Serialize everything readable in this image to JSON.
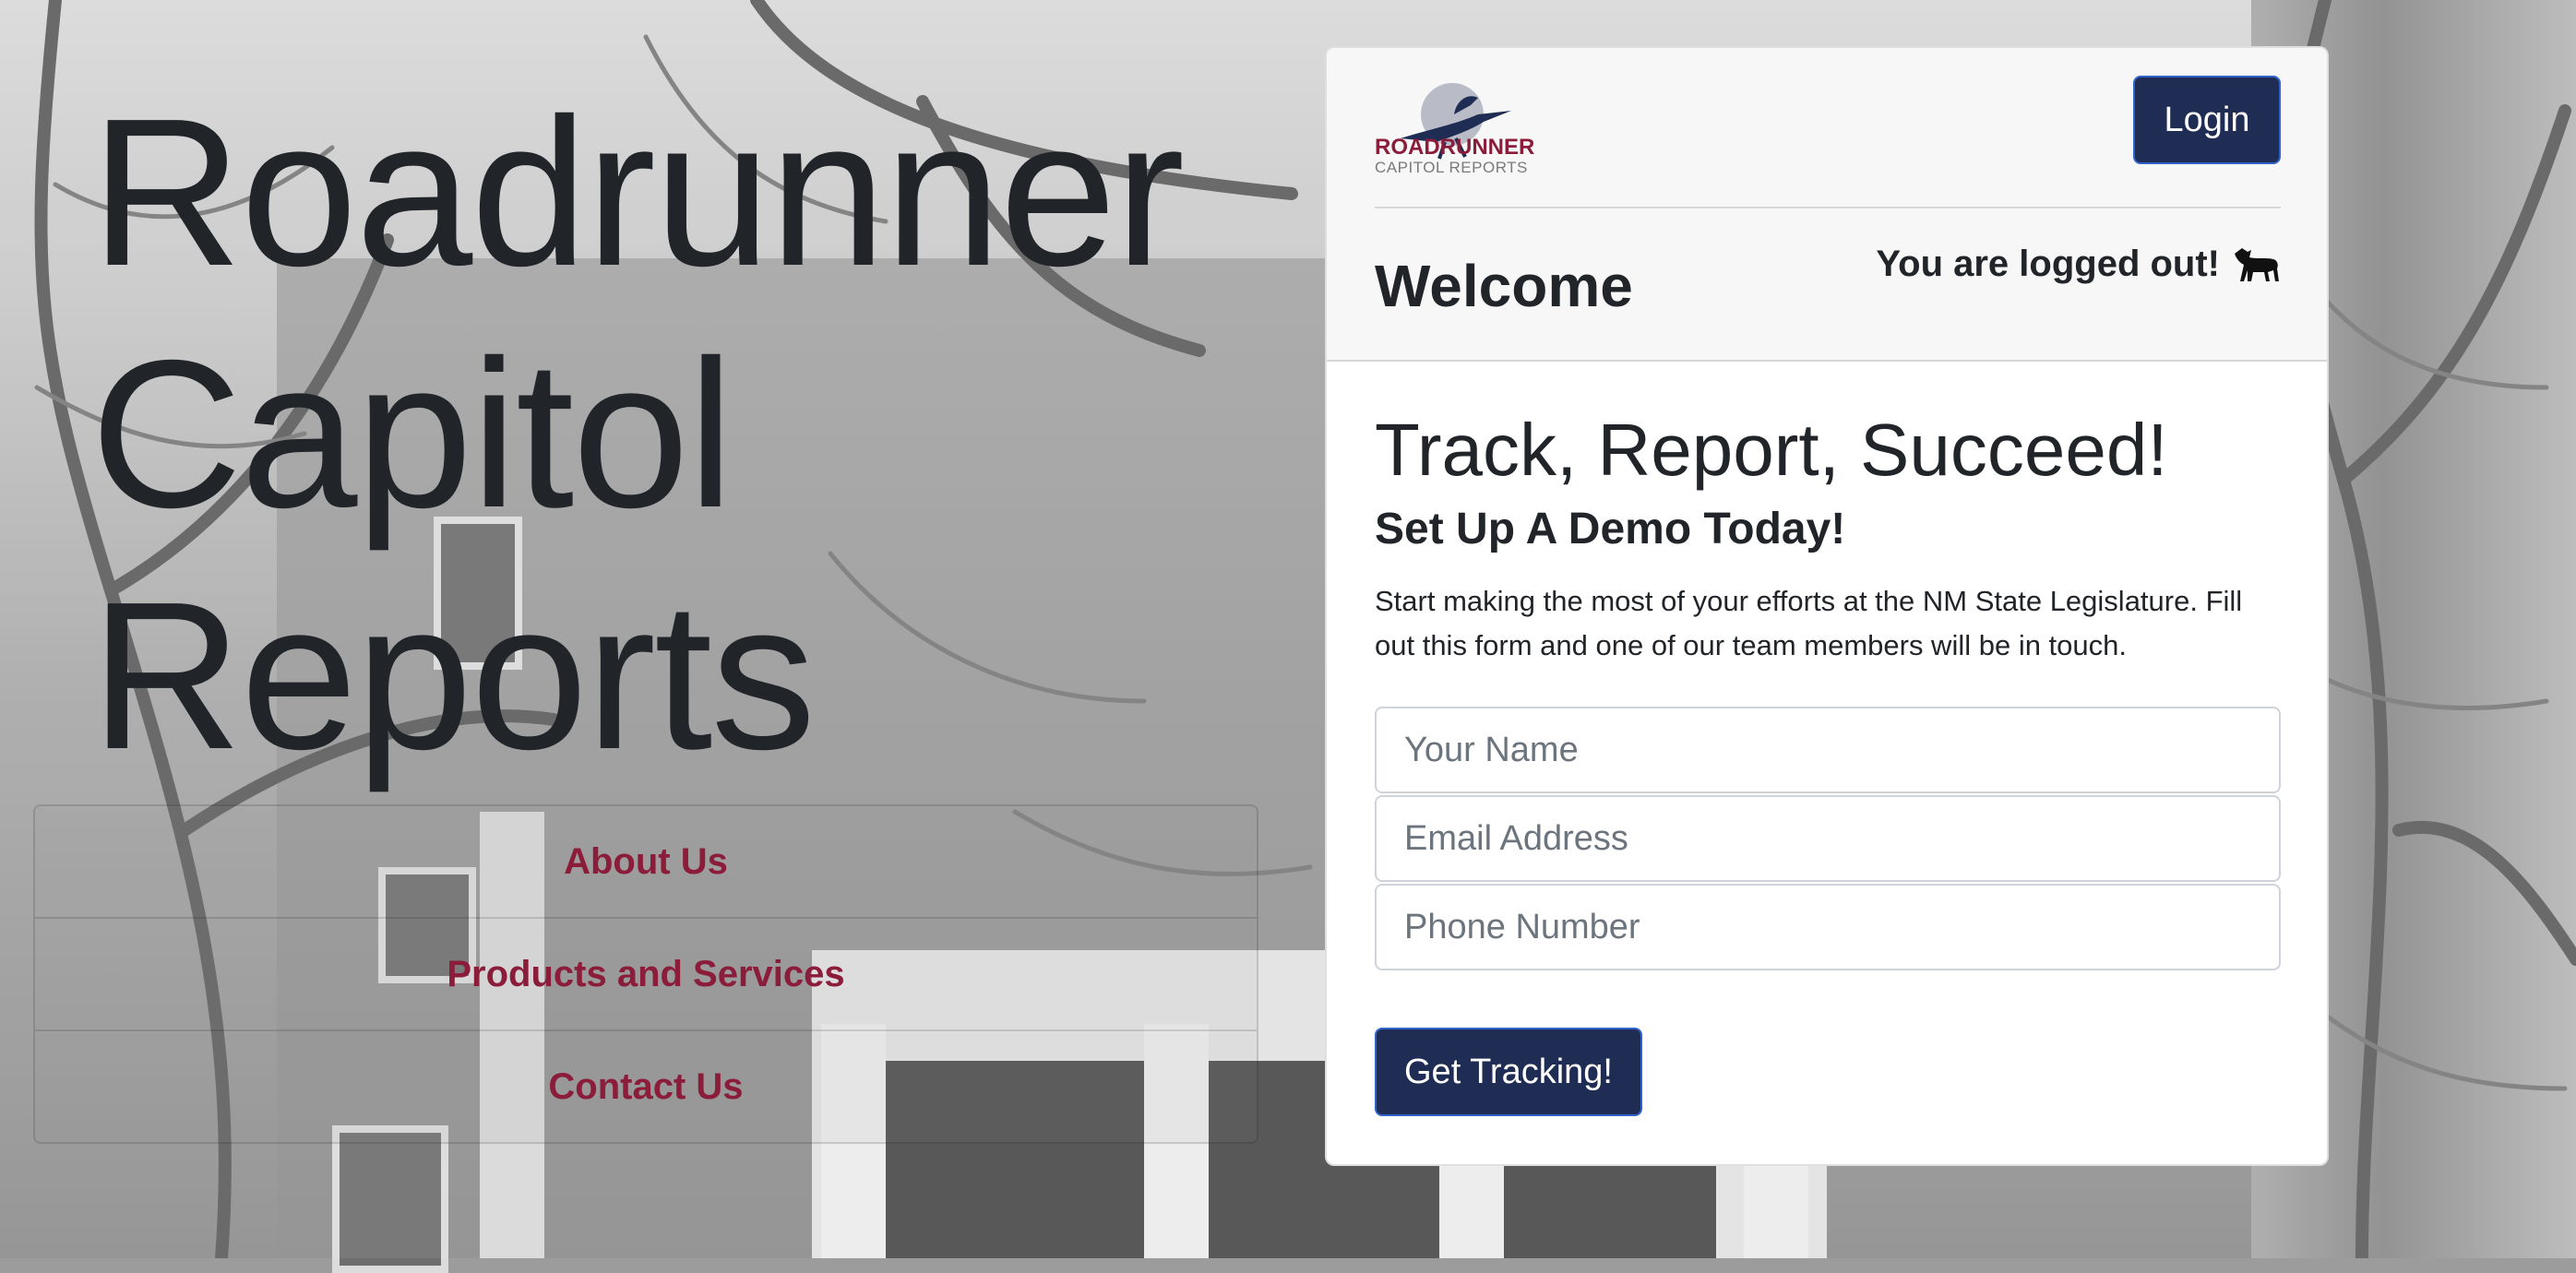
{
  "hero": {
    "line1": "Roadrunner",
    "line2": "Capitol",
    "line3": "Reports"
  },
  "nav": {
    "items": [
      {
        "label": "About Us"
      },
      {
        "label": "Products and Services"
      },
      {
        "label": "Contact Us"
      }
    ]
  },
  "header": {
    "logo_line1": "ROADRUNNER",
    "logo_line2": "CAPITOL REPORTS",
    "login_label": "Login",
    "welcome": "Welcome",
    "status": "You are logged out!",
    "status_icon": "coyote-icon"
  },
  "main": {
    "tagline": "Track, Report, Succeed!",
    "demo_title": "Set Up A Demo Today!",
    "intro": "Start making the most of your efforts at the NM State Legislature. Fill out this form and one of our team members will be in touch.",
    "form": {
      "name_placeholder": "Your Name",
      "email_placeholder": "Email Address",
      "phone_placeholder": "Phone Number",
      "submit_label": "Get Tracking!"
    }
  },
  "colors": {
    "brand_navy": "#1f2d54",
    "brand_maroon": "#8b1c3a",
    "button_border": "#2f63c9"
  }
}
